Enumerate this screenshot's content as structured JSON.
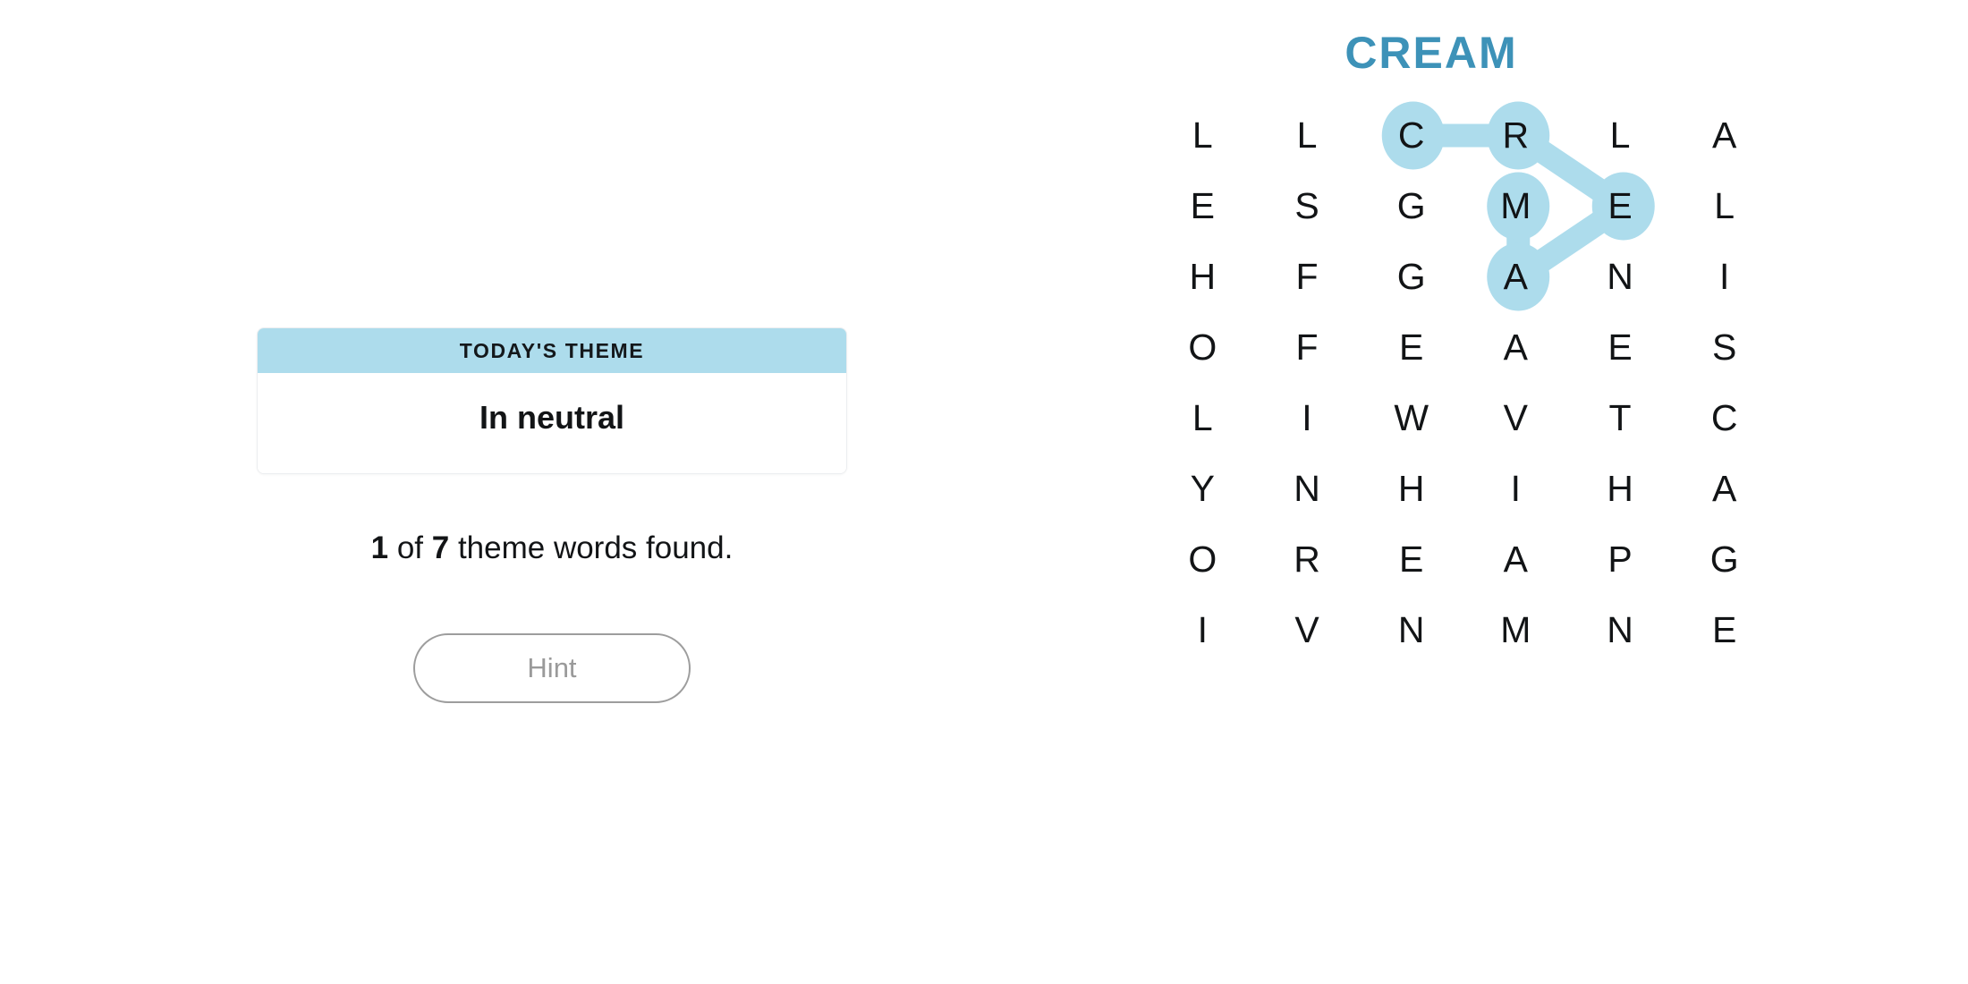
{
  "colors": {
    "highlight": "#addcec",
    "title_blue": "#3d92b8",
    "text_dark": "#121416",
    "muted_gray": "#9a9a9a",
    "card_border": "#eceef0",
    "background": "#ffffff"
  },
  "theme_card": {
    "header_label": "TODAY'S THEME",
    "theme_text": "In neutral"
  },
  "progress": {
    "found_count": "1",
    "connector_word": " of ",
    "total_count": "7",
    "suffix": " theme words found.",
    "full_text": "1 of 7 theme words found."
  },
  "hint_button": {
    "label": "Hint"
  },
  "puzzle": {
    "found_word_title": "CREAM",
    "rows": 8,
    "columns": 6,
    "grid": [
      [
        "L",
        "L",
        "C",
        "R",
        "L",
        "A"
      ],
      [
        "E",
        "S",
        "G",
        "M",
        "E",
        "L"
      ],
      [
        "H",
        "F",
        "G",
        "A",
        "N",
        "I"
      ],
      [
        "O",
        "F",
        "E",
        "A",
        "E",
        "S"
      ],
      [
        "L",
        "I",
        "W",
        "V",
        "T",
        "C"
      ],
      [
        "Y",
        "N",
        "H",
        "I",
        "H",
        "A"
      ],
      [
        "O",
        "R",
        "E",
        "A",
        "P",
        "G"
      ],
      [
        "I",
        "V",
        "N",
        "M",
        "N",
        "E"
      ]
    ],
    "highlighted_path": {
      "word": "CREAM",
      "cells": [
        {
          "letter": "C",
          "row": 0,
          "col": 2
        },
        {
          "letter": "R",
          "row": 0,
          "col": 3
        },
        {
          "letter": "E",
          "row": 1,
          "col": 4
        },
        {
          "letter": "A",
          "row": 2,
          "col": 3
        },
        {
          "letter": "M",
          "row": 1,
          "col": 3
        }
      ]
    }
  }
}
